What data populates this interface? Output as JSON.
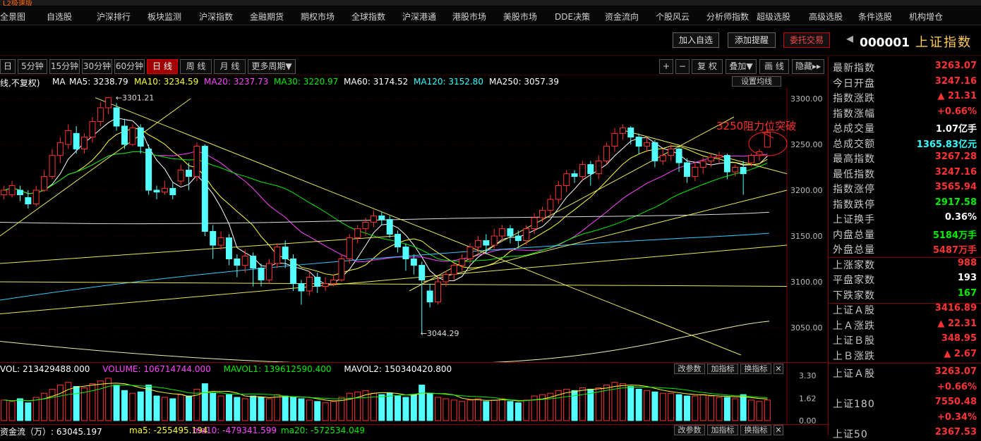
{
  "menu": [
    "全景图",
    "自选股",
    "沪深排行",
    "板块监测",
    "沪深指数",
    "金融期货",
    "期权市场",
    "全球指数",
    "沪深港通",
    "港股市场",
    "美股市场",
    "DDE决策",
    "资金流向",
    "个股风云",
    "分析师指数",
    "超级选股",
    "高级选股",
    "条件选股",
    "机构增仓"
  ],
  "actions": {
    "add_watch": "加入自选",
    "add_alert": "添加提醒",
    "trade": "委托交易"
  },
  "index": {
    "code": "000001",
    "name": "上证指数"
  },
  "periods": [
    "日",
    "5分钟",
    "15分钟",
    "30分钟",
    "60分钟",
    "日 线",
    "周 线",
    "月 线",
    "更多周期▼"
  ],
  "tools": [
    "+",
    "−",
    "复 权",
    "叠加▼",
    "画 线",
    "隐藏▸▸"
  ],
  "ma_legend": {
    "mode": "线,不复权)",
    "ma": "MA",
    "ma5": "MA5: 3238.79",
    "ma10": "MA10: 3234.59",
    "ma20": "MA20: 3237.73",
    "ma30": "MA30: 3220.97",
    "ma60": "MA60: 3174.52",
    "ma120": "MA120: 3152.80",
    "ma250": "MA250: 3057.39",
    "settings": "设置均线"
  },
  "y_axis": [
    "3300.00",
    "3250.00",
    "3200.00",
    "3150.00",
    "3100.00",
    "3050.00"
  ],
  "high_label": "3301.21",
  "low_label": "3044.29",
  "annotation": "3250阻力位突破",
  "volume": {
    "legend_vol": "VOL: 213429488.000",
    "legend_volume": "VOLUME: 106714744.000",
    "legend_mavol1": "MAVOL1: 139612590.400",
    "legend_mavol2": "MAVOL2: 150340420.800",
    "axis": [
      "3.30",
      "1.62",
      "0.00"
    ],
    "btns": [
      "改参数",
      "加指标",
      "换指标",
      "✕"
    ]
  },
  "flow": {
    "label": "资金流（万）: 63045.197",
    "ma5": "ma5: -255495.194",
    "ma10": "ma10: -479341.599",
    "ma20": "ma20: -572534.049",
    "btns": [
      "改参数",
      "加指标",
      "换指标",
      "✕"
    ]
  },
  "quote": [
    {
      "label": "最新指数",
      "value": "3263.07",
      "color": "red"
    },
    {
      "label": "今日开盘",
      "value": "3247.16",
      "color": "red"
    },
    {
      "label": "指数涨跌",
      "value": "▲ 21.31",
      "color": "red"
    },
    {
      "label": "指数涨幅",
      "value": "+0.66%",
      "color": "red"
    },
    {
      "label": "总成交量",
      "value": "1.07亿手",
      "color": "white"
    },
    {
      "label": "总成交额",
      "value": "1365.83亿元",
      "color": "cyan"
    },
    {
      "label": "最高指数",
      "value": "3267.28",
      "color": "red"
    },
    {
      "label": "最低指数",
      "value": "3247.16",
      "color": "red"
    },
    {
      "label": "指数涨停",
      "value": "3565.94",
      "color": "red"
    },
    {
      "label": "指数跌停",
      "value": "2917.58",
      "color": "green"
    },
    {
      "label": "上证换手",
      "value": "0.36%",
      "color": "white"
    },
    {
      "label": "内盘总量",
      "value": "5184万手",
      "color": "green"
    },
    {
      "label": "外盘总量",
      "value": "5487万手",
      "color": "red"
    },
    {
      "label": "上涨家数",
      "value": "988",
      "color": "red"
    },
    {
      "label": "平盘家数",
      "value": "193",
      "color": "white"
    },
    {
      "label": "下跌家数",
      "value": "167",
      "color": "green"
    },
    {
      "label": "上证Ａ股",
      "value": "3416.89",
      "color": "red"
    },
    {
      "label": "上Ａ涨跌",
      "value": "▲ 22.31",
      "color": "red"
    },
    {
      "label": "上证Ｂ股",
      "value": "348.95",
      "color": "red"
    },
    {
      "label": "上Ｂ涨跌",
      "value": "▲ 2.67",
      "color": "red"
    },
    {
      "label": "上证Ａ股",
      "value": "3263.07",
      "color": "red"
    },
    {
      "label": "",
      "value": "+0.66%",
      "color": "red"
    },
    {
      "label": "上证180",
      "value": "7550.48",
      "color": "red"
    },
    {
      "label": "",
      "value": "+0.34%",
      "color": "red"
    },
    {
      "label": "上证50",
      "value": "2367.53",
      "color": "red"
    }
  ],
  "chart_data": {
    "type": "candlestick",
    "ylim": [
      3020,
      3320
    ],
    "candles": [
      [
        3195,
        3200,
        3190,
        3205
      ],
      [
        3195,
        3205,
        3192,
        3210
      ],
      [
        3200,
        3195,
        3188,
        3205
      ],
      [
        3192,
        3185,
        3180,
        3200
      ],
      [
        3185,
        3200,
        3182,
        3205
      ],
      [
        3200,
        3215,
        3198,
        3222
      ],
      [
        3215,
        3238,
        3212,
        3245
      ],
      [
        3238,
        3252,
        3230,
        3258
      ],
      [
        3250,
        3265,
        3245,
        3272
      ],
      [
        3262,
        3245,
        3240,
        3270
      ],
      [
        3245,
        3258,
        3240,
        3262
      ],
      [
        3258,
        3275,
        3252,
        3280
      ],
      [
        3275,
        3290,
        3270,
        3296
      ],
      [
        3290,
        3301,
        3283,
        3302
      ],
      [
        3290,
        3270,
        3265,
        3295
      ],
      [
        3270,
        3250,
        3245,
        3278
      ],
      [
        3250,
        3268,
        3248,
        3272
      ],
      [
        3268,
        3248,
        3240,
        3272
      ],
      [
        3245,
        3200,
        3195,
        3250
      ],
      [
        3200,
        3198,
        3190,
        3205
      ],
      [
        3198,
        3202,
        3195,
        3210
      ],
      [
        3202,
        3195,
        3190,
        3208
      ],
      [
        3210,
        3222,
        3205,
        3228
      ],
      [
        3222,
        3215,
        3200,
        3230
      ],
      [
        3215,
        3248,
        3210,
        3252
      ],
      [
        3248,
        3155,
        3150,
        3250
      ],
      [
        3155,
        3140,
        3125,
        3162
      ],
      [
        3140,
        3148,
        3135,
        3155
      ],
      [
        3148,
        3125,
        3118,
        3152
      ],
      [
        3125,
        3118,
        3105,
        3130
      ],
      [
        3118,
        3128,
        3110,
        3135
      ],
      [
        3128,
        3115,
        3095,
        3132
      ],
      [
        3115,
        3102,
        3095,
        3120
      ],
      [
        3102,
        3120,
        3098,
        3125
      ],
      [
        3120,
        3138,
        3115,
        3142
      ],
      [
        3138,
        3125,
        3115,
        3145
      ],
      [
        3125,
        3098,
        3090,
        3130
      ],
      [
        3098,
        3090,
        3075,
        3102
      ],
      [
        3090,
        3105,
        3085,
        3112
      ],
      [
        3105,
        3095,
        3088,
        3110
      ],
      [
        3095,
        3098,
        3090,
        3105
      ],
      [
        3098,
        3102,
        3095,
        3108
      ],
      [
        3102,
        3125,
        3100,
        3130
      ],
      [
        3125,
        3148,
        3120,
        3152
      ],
      [
        3148,
        3158,
        3142,
        3162
      ],
      [
        3158,
        3165,
        3150,
        3170
      ],
      [
        3165,
        3172,
        3160,
        3178
      ],
      [
        3172,
        3168,
        3162,
        3176
      ],
      [
        3168,
        3152,
        3148,
        3172
      ],
      [
        3152,
        3138,
        3132,
        3156
      ],
      [
        3138,
        3125,
        3112,
        3142
      ],
      [
        3125,
        3118,
        3108,
        3130
      ],
      [
        3118,
        3102,
        3044,
        3122
      ],
      [
        3090,
        3078,
        3072,
        3098
      ],
      [
        3078,
        3100,
        3075,
        3105
      ],
      [
        3100,
        3108,
        3095,
        3112
      ],
      [
        3108,
        3118,
        3102,
        3122
      ],
      [
        3118,
        3125,
        3112,
        3130
      ],
      [
        3125,
        3138,
        3120,
        3142
      ],
      [
        3138,
        3145,
        3132,
        3150
      ],
      [
        3145,
        3140,
        3130,
        3152
      ],
      [
        3140,
        3150,
        3136,
        3158
      ],
      [
        3150,
        3158,
        3145,
        3162
      ],
      [
        3158,
        3150,
        3142,
        3162
      ],
      [
        3150,
        3145,
        3138,
        3156
      ],
      [
        3145,
        3158,
        3140,
        3162
      ],
      [
        3158,
        3170,
        3152,
        3175
      ],
      [
        3170,
        3178,
        3165,
        3182
      ],
      [
        3178,
        3190,
        3172,
        3195
      ],
      [
        3190,
        3205,
        3185,
        3210
      ],
      [
        3205,
        3218,
        3198,
        3222
      ],
      [
        3218,
        3215,
        3208,
        3222
      ],
      [
        3215,
        3228,
        3210,
        3232
      ],
      [
        3228,
        3218,
        3205,
        3232
      ],
      [
        3218,
        3232,
        3212,
        3238
      ],
      [
        3232,
        3248,
        3228,
        3252
      ],
      [
        3248,
        3262,
        3242,
        3268
      ],
      [
        3262,
        3268,
        3255,
        3272
      ],
      [
        3268,
        3258,
        3250,
        3270
      ],
      [
        3258,
        3248,
        3240,
        3262
      ],
      [
        3248,
        3252,
        3242,
        3258
      ],
      [
        3252,
        3232,
        3225,
        3255
      ],
      [
        3232,
        3238,
        3228,
        3245
      ],
      [
        3238,
        3245,
        3232,
        3250
      ],
      [
        3245,
        3230,
        3220,
        3248
      ],
      [
        3230,
        3215,
        3208,
        3235
      ],
      [
        3215,
        3225,
        3210,
        3230
      ],
      [
        3225,
        3232,
        3218,
        3236
      ],
      [
        3232,
        3236,
        3225,
        3240
      ],
      [
        3236,
        3238,
        3230,
        3242
      ],
      [
        3238,
        3220,
        3212,
        3240
      ],
      [
        3220,
        3225,
        3215,
        3228
      ],
      [
        3225,
        3218,
        3195,
        3232
      ],
      [
        3230,
        3238,
        3226,
        3240
      ],
      [
        3238,
        3242,
        3232,
        3245
      ],
      [
        3247,
        3263,
        3247,
        3267
      ]
    ],
    "volumes": [
      1.5,
      1.4,
      1.6,
      1.3,
      1.7,
      2.0,
      2.3,
      2.6,
      2.8,
      2.5,
      2.4,
      2.7,
      2.9,
      3.1,
      2.6,
      2.2,
      2.0,
      2.1,
      2.6,
      1.8,
      1.7,
      1.6,
      1.9,
      1.8,
      2.3,
      2.7,
      2.0,
      1.8,
      1.9,
      1.7,
      1.6,
      1.8,
      1.7,
      1.6,
      1.9,
      1.8,
      1.7,
      1.6,
      1.5,
      1.4,
      1.3,
      1.4,
      1.7,
      2.0,
      2.1,
      2.2,
      2.0,
      1.9,
      2.0,
      1.8,
      1.7,
      1.9,
      2.6,
      2.0,
      1.7,
      1.6,
      1.5,
      1.4,
      1.5,
      1.6,
      1.4,
      1.5,
      1.6,
      1.4,
      1.3,
      1.5,
      1.8,
      1.9,
      2.0,
      2.2,
      2.3,
      2.2,
      2.4,
      2.3,
      2.4,
      2.6,
      2.8,
      2.7,
      2.5,
      2.3,
      2.2,
      2.1,
      2.0,
      2.0,
      1.9,
      1.8,
      1.8,
      1.9,
      1.8,
      1.7,
      1.7,
      1.6,
      1.9,
      1.5,
      1.4,
      1.5
    ]
  }
}
